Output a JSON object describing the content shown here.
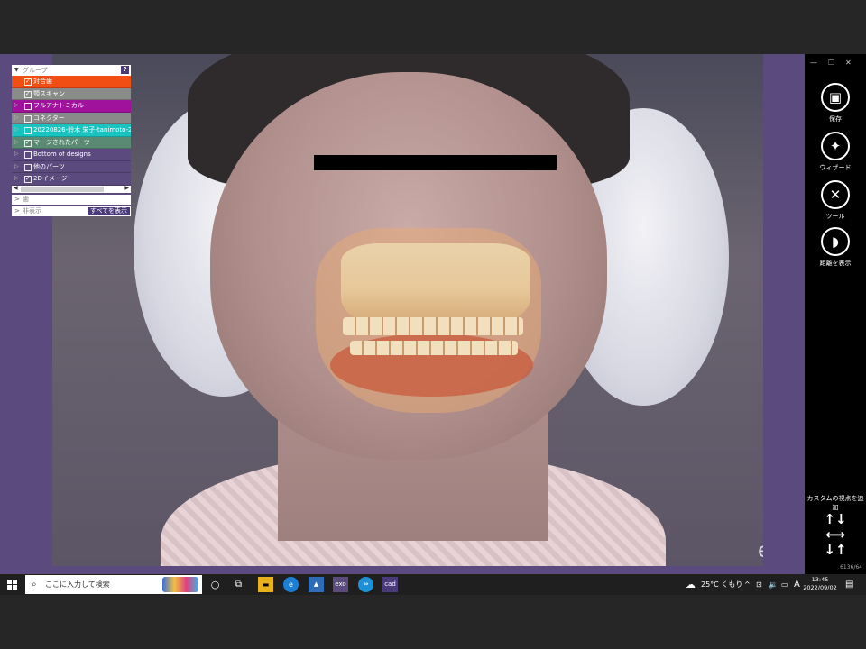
{
  "panel": {
    "header": "グループ",
    "help": "?",
    "items": [
      {
        "label": "対合歯",
        "checked": true,
        "color": "#f04e12"
      },
      {
        "label": "顎スキャン",
        "checked": true,
        "color": "#8a8a8a"
      },
      {
        "label": "フルアナトミカル",
        "checked": false,
        "color": "#a0129c"
      },
      {
        "label": "コネクター",
        "checked": false,
        "color": "#8a8a8a"
      },
      {
        "label": "20220826-鈴木 栄子-tanimoto-27-s",
        "checked": false,
        "color": "#19c4c0"
      },
      {
        "label": "マージされたパーツ",
        "checked": true,
        "color": "#5a8a74"
      },
      {
        "label": "Bottom of designs",
        "checked": false,
        "color": "#5a4a7e"
      },
      {
        "label": "他のパーツ",
        "checked": false,
        "color": "#5a4a7e"
      },
      {
        "label": "2Dイメージ",
        "checked": true,
        "color": "#5a4a7e"
      }
    ],
    "section_teeth": "歯",
    "section_hidden": "非表示",
    "show_all": "すべてを表示"
  },
  "sidebar": {
    "save": "保存",
    "wizard": "ウィザード",
    "tools": "ツール",
    "show_distance": "距離を表示",
    "custom_view": "カスタムの視点を追加",
    "version": "6136/64"
  },
  "watermark": "exocad",
  "taskbar": {
    "search_placeholder": "ここに入力して検索",
    "icon_exo": "exo",
    "icon_cad": "cad",
    "weather": "25°C くもり",
    "ime": "A",
    "time": "13:45",
    "date": "2022/09/02"
  }
}
